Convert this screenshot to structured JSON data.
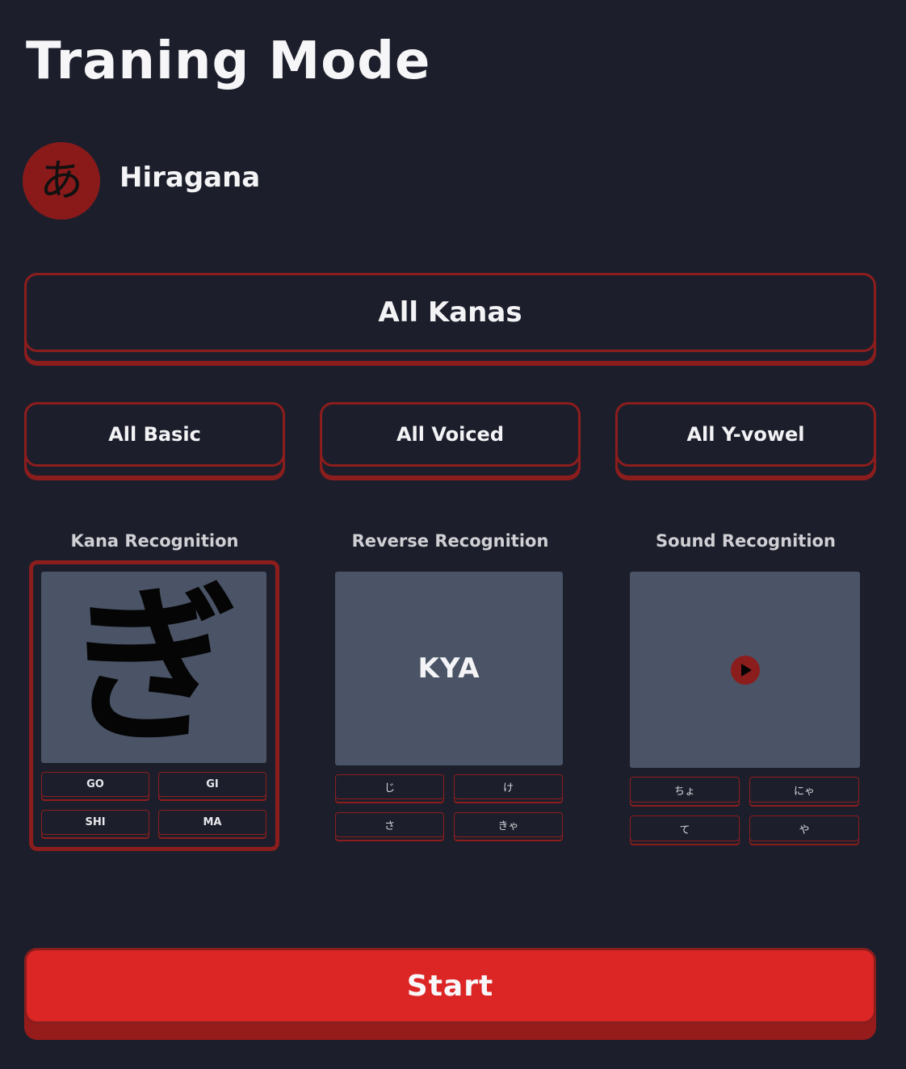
{
  "page_title": "Traning Mode",
  "kana_set": {
    "icon_char": "あ",
    "label": "Hiragana"
  },
  "groups": {
    "all": "All Kanas",
    "basic": "All Basic",
    "voiced": "All Voiced",
    "yvowel": "All Y-vowel"
  },
  "modes": [
    {
      "title": "Kana Recognition",
      "selected": true,
      "prompt": "ぎ",
      "options": [
        "GO",
        "GI",
        "SHI",
        "MA"
      ]
    },
    {
      "title": "Reverse Recognition",
      "selected": false,
      "prompt": "KYA",
      "options": [
        "じ",
        "け",
        "さ",
        "きゃ"
      ]
    },
    {
      "title": "Sound Recognition",
      "selected": false,
      "prompt_icon": "play-icon",
      "options": [
        "ちょ",
        "にゃ",
        "て",
        "や"
      ]
    }
  ],
  "start_label": "Start",
  "colors": {
    "background": "#1c1f2b",
    "accent": "#8c1d1d",
    "start": "#dc2626",
    "preview": "#4a5466"
  }
}
